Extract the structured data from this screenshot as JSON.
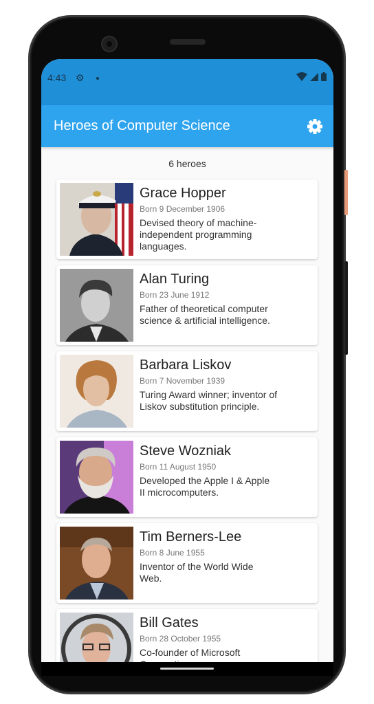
{
  "status": {
    "time": "4:43"
  },
  "appbar": {
    "title": "Heroes of Computer Science"
  },
  "hero_count": "6 heroes",
  "heroes": [
    {
      "name": "Grace Hopper",
      "born": "Born 9 December 1906",
      "desc": "Devised theory of machine-independent programming languages."
    },
    {
      "name": "Alan Turing",
      "born": "Born 23 June 1912",
      "desc": "Father of theoretical computer science & artificial intelligence."
    },
    {
      "name": "Barbara Liskov",
      "born": "Born 7 November 1939",
      "desc": "Turing Award winner; inventor of Liskov substitution principle."
    },
    {
      "name": "Steve Wozniak",
      "born": "Born 11 August 1950",
      "desc": "Developed the Apple I & Apple II microcomputers."
    },
    {
      "name": "Tim Berners-Lee",
      "born": "Born 8 June 1955",
      "desc": "Inventor of the World Wide Web."
    },
    {
      "name": "Bill Gates",
      "born": "Born 28 October 1955",
      "desc": "Co-founder of Microsoft Corporation."
    }
  ],
  "colors": {
    "status_bar": "#1f8fd8",
    "app_bar": "#2ea4ef",
    "background": "#fafafa"
  }
}
